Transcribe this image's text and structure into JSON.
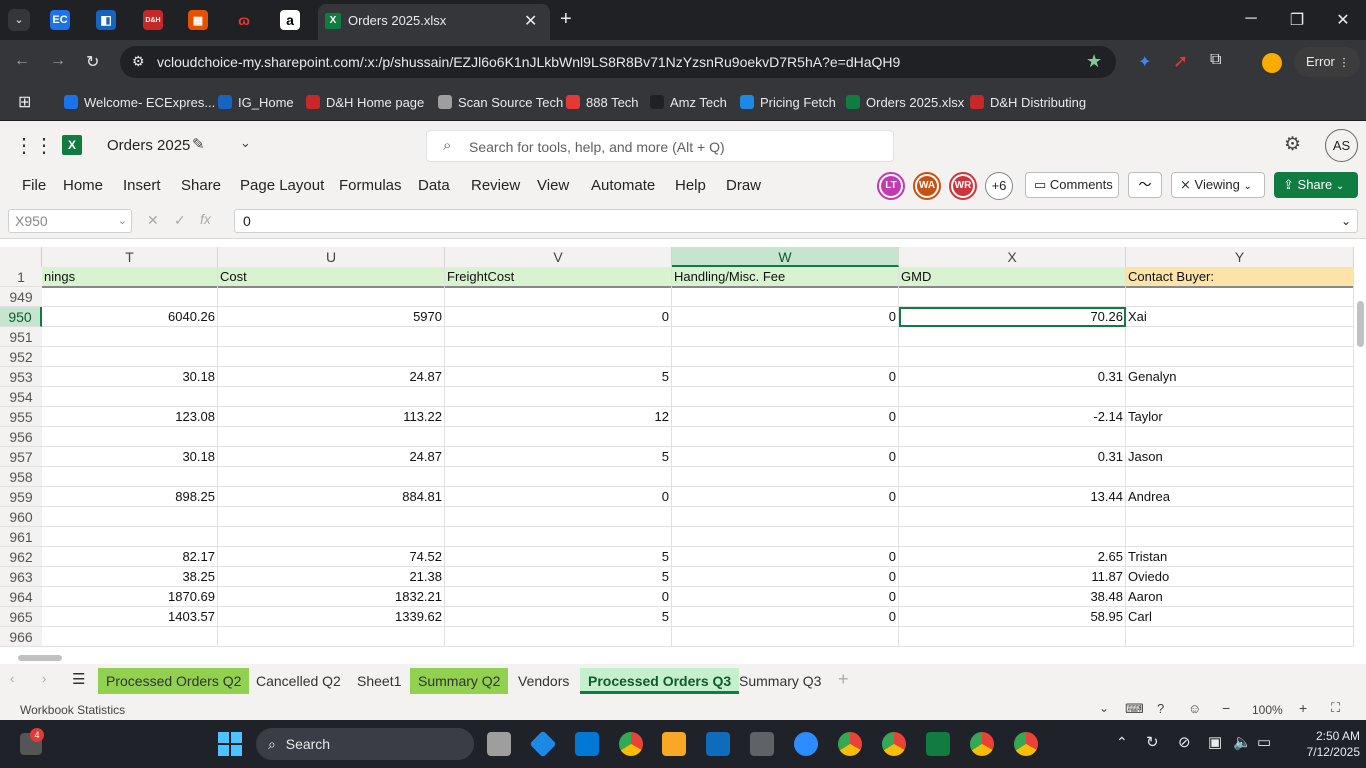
{
  "browser": {
    "tabs": [
      {
        "label": "EC"
      },
      {
        "label": "D&H"
      },
      {
        "label": ""
      },
      {
        "label": ""
      },
      {
        "label": "a"
      }
    ],
    "active_tab_title": "Orders 2025.xlsx",
    "url": "vcloudchoice-my.sharepoint.com/:x:/p/shussain/EZJl6o6K1nJLkbWnl9LS8R8Bv71NzYzsnRu9oekvD7R5hA?e=dHaQH9",
    "profile_status": "Error",
    "bookmarks": [
      {
        "label": "Welcome- ECExpres...",
        "color": "#1a73e8"
      },
      {
        "label": "IG_Home",
        "color": "#1565c0"
      },
      {
        "label": "D&H Home page",
        "color": "#c62828"
      },
      {
        "label": "Scan Source Tech",
        "color": "#9e9e9e"
      },
      {
        "label": "888 Tech",
        "color": "#e53935"
      },
      {
        "label": "Amz Tech",
        "color": "#202124"
      },
      {
        "label": "Pricing Fetch",
        "color": "#1e88e5"
      },
      {
        "label": "Orders 2025.xlsx",
        "color": "#107c41"
      },
      {
        "label": "D&H Distributing",
        "color": "#c62828"
      }
    ]
  },
  "excel": {
    "doc_title": "Orders 2025",
    "search_placeholder": "Search for tools, help, and more (Alt + Q)",
    "user_initials": "AS",
    "menu": [
      "File",
      "Home",
      "Insert",
      "Share",
      "Page Layout",
      "Formulas",
      "Data",
      "Review",
      "View",
      "Automate",
      "Help",
      "Draw"
    ],
    "collaborators": [
      {
        "initials": "LT",
        "color": "#c239b3"
      },
      {
        "initials": "WA",
        "color": "#ca5010"
      },
      {
        "initials": "WR",
        "color": "#d13438"
      }
    ],
    "collab_more": "+6",
    "comments_label": "Comments",
    "viewing_label": "Viewing",
    "share_label": "Share",
    "name_box": "X950",
    "formula_value": "0",
    "columns": [
      "T",
      "U",
      "V",
      "W",
      "X",
      "Y"
    ],
    "header_row_number": "1",
    "header_cells": [
      "nings",
      "Cost",
      "FreightCost",
      "Handling/Misc. Fee",
      "GMD",
      "Contact Buyer:"
    ],
    "rows": [
      {
        "n": "949",
        "c": [
          "",
          "",
          "",
          "",
          "",
          ""
        ]
      },
      {
        "n": "950",
        "c": [
          "6040.26",
          "5970",
          "0",
          "0",
          "70.26",
          "Xai"
        ]
      },
      {
        "n": "951",
        "c": [
          "",
          "",
          "",
          "",
          "",
          ""
        ]
      },
      {
        "n": "952",
        "c": [
          "",
          "",
          "",
          "",
          "",
          ""
        ]
      },
      {
        "n": "953",
        "c": [
          "30.18",
          "24.87",
          "5",
          "0",
          "0.31",
          "Genalyn"
        ]
      },
      {
        "n": "954",
        "c": [
          "",
          "",
          "",
          "",
          "",
          ""
        ]
      },
      {
        "n": "955",
        "c": [
          "123.08",
          "113.22",
          "12",
          "0",
          "-2.14",
          "Taylor"
        ]
      },
      {
        "n": "956",
        "c": [
          "",
          "",
          "",
          "",
          "",
          ""
        ]
      },
      {
        "n": "957",
        "c": [
          "30.18",
          "24.87",
          "5",
          "0",
          "0.31",
          "Jason"
        ]
      },
      {
        "n": "958",
        "c": [
          "",
          "",
          "",
          "",
          "",
          ""
        ]
      },
      {
        "n": "959",
        "c": [
          "898.25",
          "884.81",
          "0",
          "0",
          "13.44",
          "Andrea"
        ]
      },
      {
        "n": "960",
        "c": [
          "",
          "",
          "",
          "",
          "",
          ""
        ]
      },
      {
        "n": "961",
        "c": [
          "",
          "",
          "",
          "",
          "",
          ""
        ]
      },
      {
        "n": "962",
        "c": [
          "82.17",
          "74.52",
          "5",
          "0",
          "2.65",
          "Tristan"
        ]
      },
      {
        "n": "963",
        "c": [
          "38.25",
          "21.38",
          "5",
          "0",
          "11.87",
          "Oviedo"
        ]
      },
      {
        "n": "964",
        "c": [
          "1870.69",
          "1832.21",
          "0",
          "0",
          "38.48",
          "Aaron"
        ]
      },
      {
        "n": "965",
        "c": [
          "1403.57",
          "1339.62",
          "5",
          "0",
          "58.95",
          "Carl"
        ]
      },
      {
        "n": "966",
        "c": [
          "",
          "",
          "",
          "",
          "",
          ""
        ]
      }
    ],
    "sheet_tabs": [
      {
        "label": "Processed Orders Q2",
        "bg": "#92d050"
      },
      {
        "label": "Cancelled Q2",
        "bg": ""
      },
      {
        "label": "Sheet1",
        "bg": ""
      },
      {
        "label": "Summary Q2",
        "bg": "#92d050"
      },
      {
        "label": "Vendors",
        "bg": ""
      },
      {
        "label": "Processed Orders Q3",
        "bg": "#c6efce",
        "active": true
      },
      {
        "label": "Summary Q3",
        "bg": ""
      }
    ],
    "status_left": "Workbook Statistics",
    "zoom": "100%"
  },
  "taskbar": {
    "search_label": "Search",
    "notification_count": "4",
    "time": "2:50 AM",
    "date": "7/12/2025"
  }
}
